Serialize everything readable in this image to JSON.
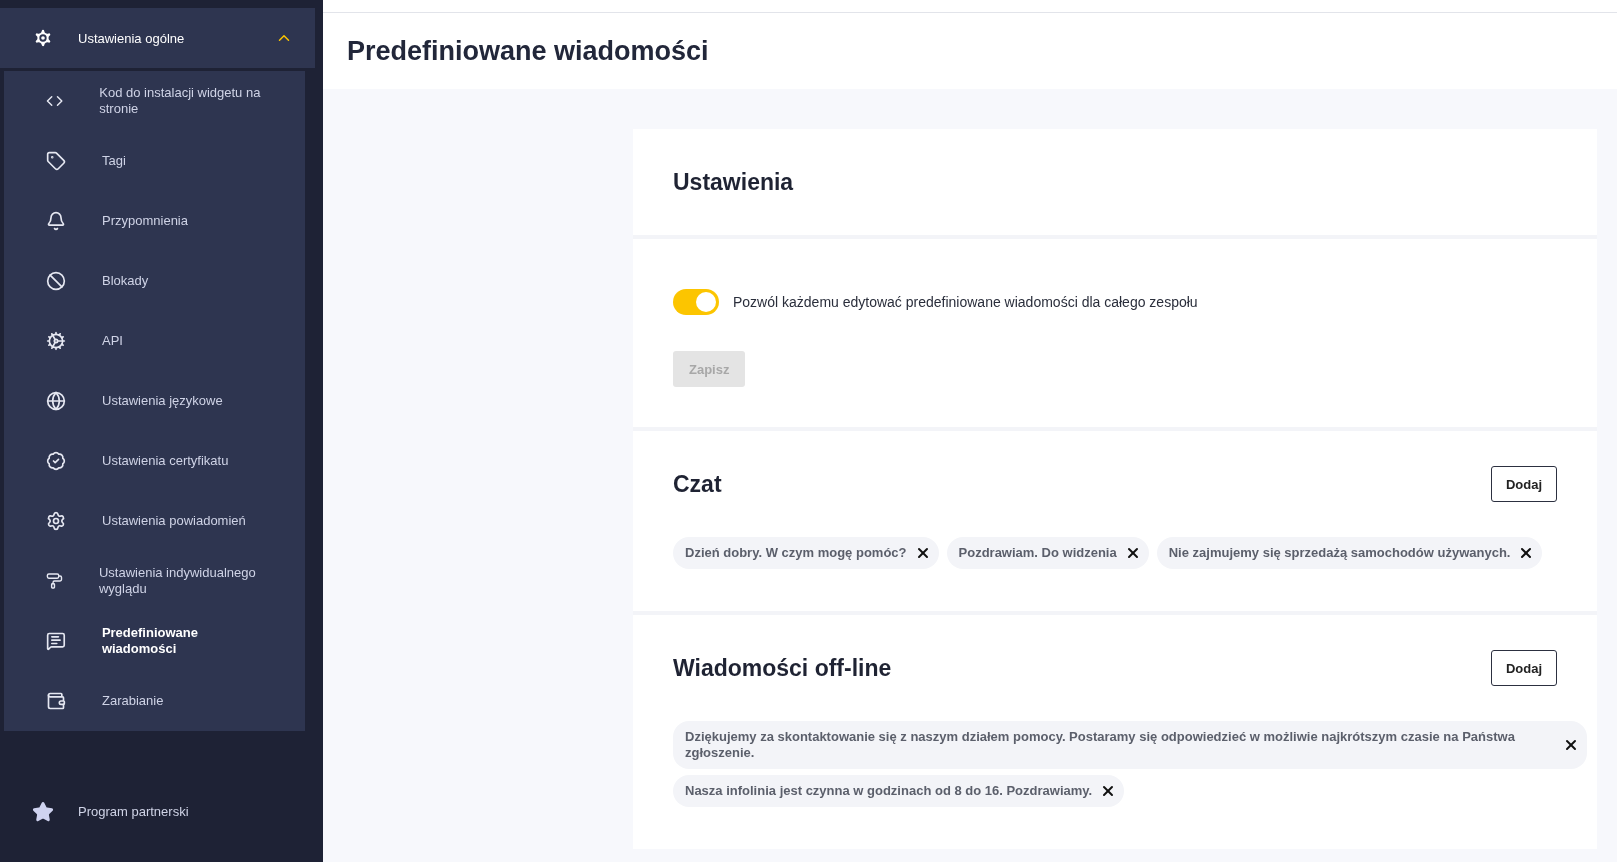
{
  "sidebar": {
    "group": {
      "label": "Ustawienia ogólne",
      "expanded": true
    },
    "items": [
      {
        "label": "Kod do instalacji widgetu na stronie",
        "selected": false
      },
      {
        "label": "Tagi",
        "selected": false
      },
      {
        "label": "Przypomnienia",
        "selected": false
      },
      {
        "label": "Blokady",
        "selected": false
      },
      {
        "label": "API",
        "selected": false
      },
      {
        "label": "Ustawienia językowe",
        "selected": false
      },
      {
        "label": "Ustawienia certyfikatu",
        "selected": false
      },
      {
        "label": "Ustawienia powiadomień",
        "selected": false
      },
      {
        "label": "Ustawienia indywidualnego wyglądu",
        "selected": false
      },
      {
        "label": "Predefiniowane wiadomości",
        "selected": true
      },
      {
        "label": "Zarabianie",
        "selected": false
      }
    ],
    "bottom_item": {
      "label": "Program partnerski"
    }
  },
  "page_title": "Predefiniowane wiadomości",
  "settings": {
    "title": "Ustawienia",
    "toggle": {
      "label": "Pozwól każdemu edytować predefiniowane wiadomości dla całego zespołu",
      "on": true
    },
    "save_button": {
      "label": "Zapisz",
      "disabled": true
    }
  },
  "sections": [
    {
      "title": "Czat",
      "add_button": "Dodaj",
      "messages": [
        "Dzień dobry. W czym mogę pomóc?",
        "Pozdrawiam. Do widzenia",
        "Nie zajmujemy się sprzedażą samochodów używanych."
      ]
    },
    {
      "title": "Wiadomości off-line",
      "add_button": "Dodaj",
      "messages": [
        "Dziękujemy za skontaktowanie się z naszym działem pomocy. Postaramy się odpowiedzieć w możliwie najkrótszym czasie na Państwa zgłoszenie.",
        "Nasza infolinia jest czynna w godzinach od 8 do 16. Pozdrawiamy."
      ]
    }
  ]
}
